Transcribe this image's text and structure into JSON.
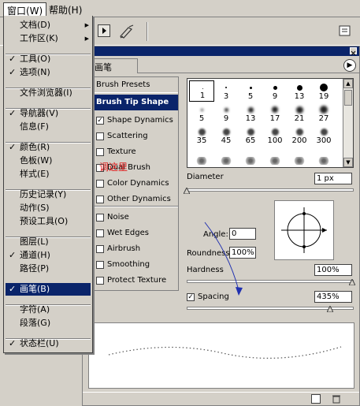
{
  "menubar": {
    "window": "窗口(W)",
    "help": "帮助(H)"
  },
  "menu": {
    "items": [
      {
        "label": "文档(D)",
        "checked": false,
        "submenu": true
      },
      {
        "label": "工作区(K)",
        "checked": false,
        "submenu": true
      },
      {
        "label": "工具(O)",
        "checked": true
      },
      {
        "label": "选项(N)",
        "checked": true
      },
      {
        "label": "文件浏览器(I)",
        "checked": false
      },
      {
        "label": "导航器(V)",
        "checked": true
      },
      {
        "label": "信息(F)",
        "checked": false
      },
      {
        "label": "颜色(R)",
        "checked": true
      },
      {
        "label": "色板(W)",
        "checked": false
      },
      {
        "label": "样式(E)",
        "checked": false
      },
      {
        "label": "历史记录(Y)",
        "checked": false
      },
      {
        "label": "动作(S)",
        "checked": false
      },
      {
        "label": "预设工具(O)",
        "checked": false
      },
      {
        "label": "图层(L)",
        "checked": false
      },
      {
        "label": "通道(H)",
        "checked": true
      },
      {
        "label": "路径(P)",
        "checked": false
      },
      {
        "label": "画笔(B)",
        "checked": true,
        "highlighted": true
      },
      {
        "label": "字符(A)",
        "checked": false
      },
      {
        "label": "段落(G)",
        "checked": false
      },
      {
        "label": "状态栏(U)",
        "checked": true
      }
    ]
  },
  "palette": {
    "tab": "画笔",
    "menu_arrow": "▶",
    "left": {
      "presets": "Brush Presets",
      "tip_shape": "Brush Tip Shape",
      "options": [
        {
          "label": "Shape Dynamics",
          "checked": true
        },
        {
          "label": "Scattering",
          "checked": false
        },
        {
          "label": "Texture",
          "checked": false
        },
        {
          "label": "Dual Brush",
          "checked": false
        },
        {
          "label": "Color Dynamics",
          "checked": false
        },
        {
          "label": "Other Dynamics",
          "checked": false
        },
        {
          "label": "Noise",
          "checked": false
        },
        {
          "label": "Wet Edges",
          "checked": false
        },
        {
          "label": "Airbrush",
          "checked": false
        },
        {
          "label": "Smoothing",
          "checked": false
        },
        {
          "label": "Protect Texture",
          "checked": false
        }
      ]
    },
    "brushes": [
      {
        "size": "1"
      },
      {
        "size": "3"
      },
      {
        "size": "5"
      },
      {
        "size": "9"
      },
      {
        "size": "13"
      },
      {
        "size": "19"
      },
      {
        "size": "5"
      },
      {
        "size": "9"
      },
      {
        "size": "13"
      },
      {
        "size": "17"
      },
      {
        "size": "21"
      },
      {
        "size": "27"
      },
      {
        "size": "35"
      },
      {
        "size": "45"
      },
      {
        "size": "65"
      },
      {
        "size": "100"
      },
      {
        "size": "200"
      },
      {
        "size": "300"
      }
    ],
    "diameter_label": "Diameter",
    "diameter_value": "1 px",
    "angle_label": "Angle:",
    "angle_value": "0",
    "roundness_label": "Roundness:",
    "roundness_value": "100%",
    "hardness_label": "Hardness",
    "hardness_value": "100%",
    "spacing_label": "Spacing",
    "spacing_value": "435%",
    "spacing_checked": true
  },
  "annotation": "调这里",
  "colors": {
    "highlight": "#0a246a",
    "annotation": "#e02020",
    "chrome": "#d4d0c8"
  }
}
